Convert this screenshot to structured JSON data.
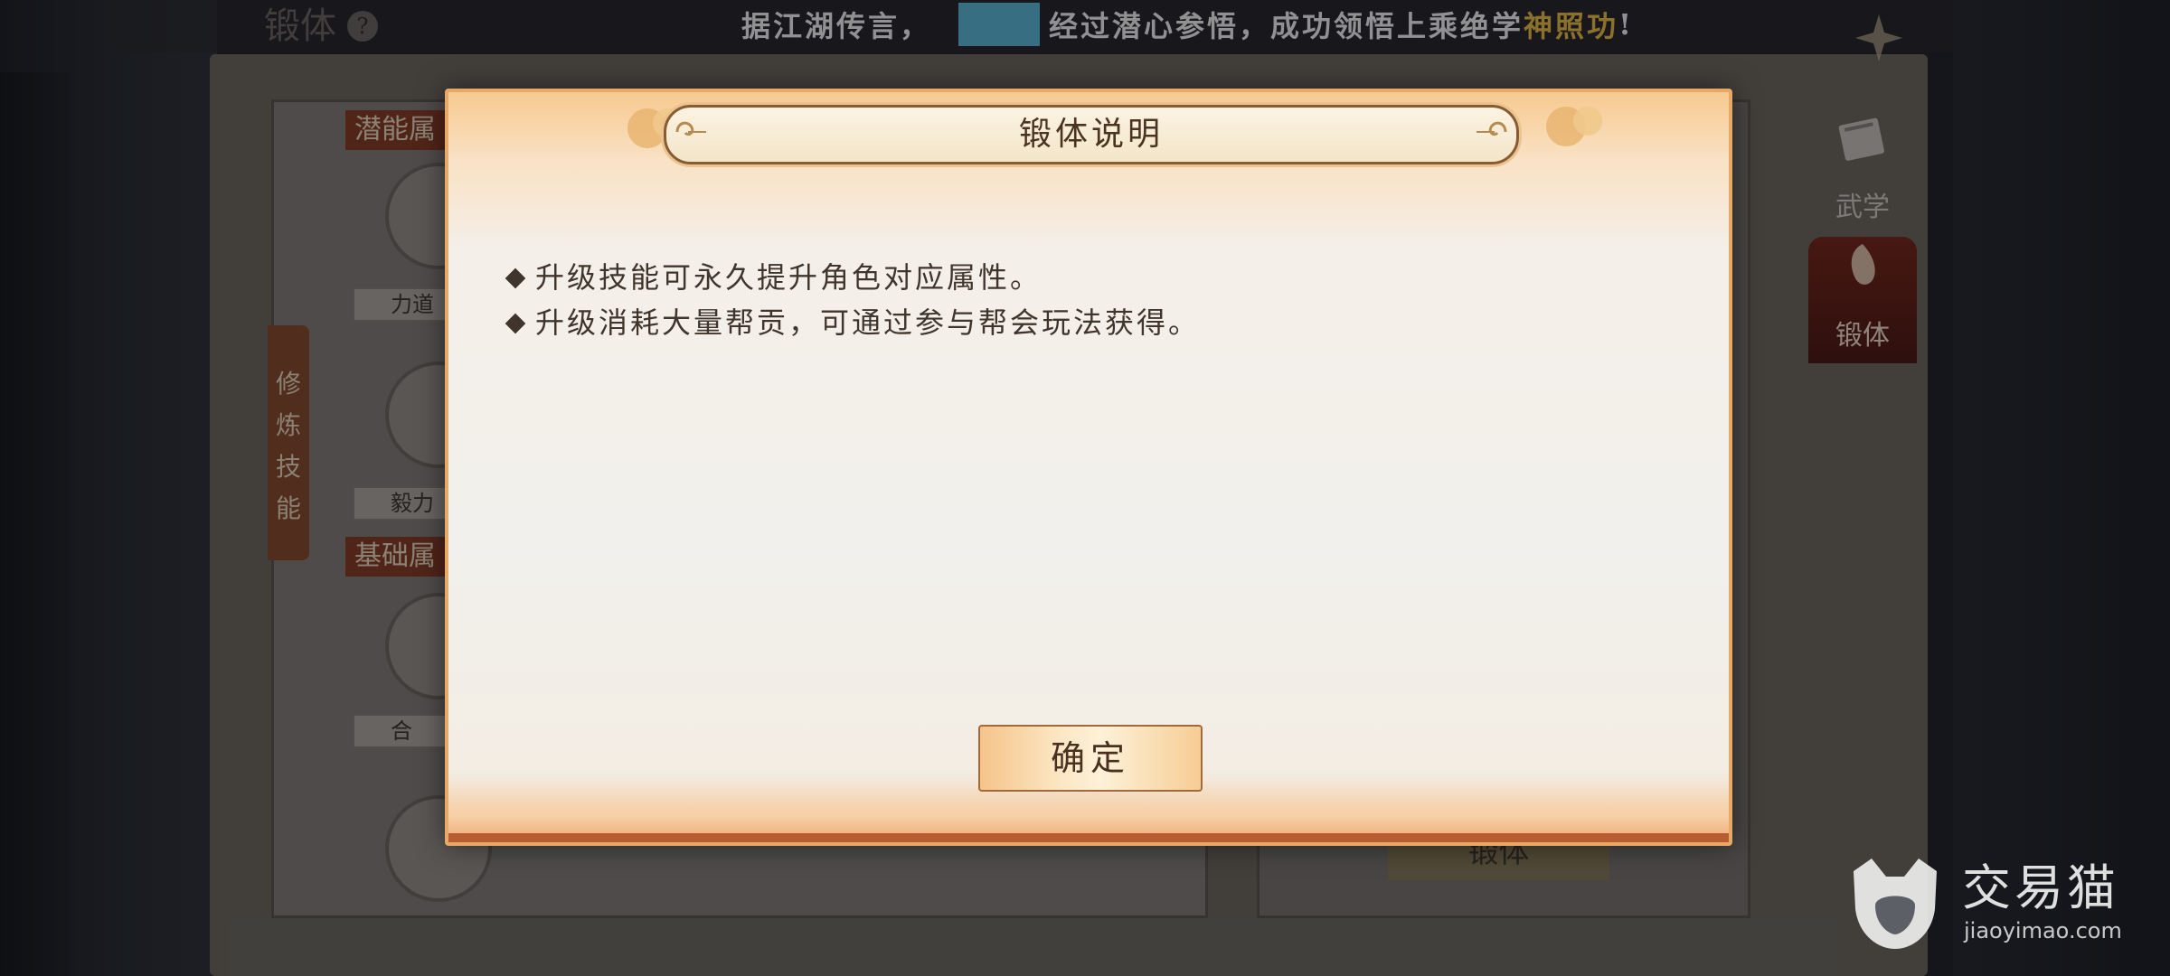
{
  "background": {
    "screen_title": "锻体",
    "help_icon": "?",
    "section_potential": "潜能属",
    "section_basic": "基础属",
    "vertical_tab": [
      "修",
      "炼",
      "技",
      "能"
    ],
    "skills": [
      "力道",
      "毅力",
      "合"
    ],
    "side_tabs": [
      {
        "label": "武学",
        "icon": "book-icon"
      },
      {
        "label": "锻体",
        "icon": "body-icon"
      }
    ],
    "forge_button": "锻体"
  },
  "marquee": {
    "prefix": "据江湖传言，",
    "middle": "经过潜心参悟，成功领悟上乘绝学",
    "highlight": "神照功",
    "suffix": "!"
  },
  "dialog": {
    "title": "锻体说明",
    "lines": [
      "升级技能可永久提升角色对应属性。",
      "升级消耗大量帮贡，可通过参与帮会玩法获得。"
    ],
    "confirm_label": "确定"
  },
  "watermark": {
    "brand": "交易猫",
    "url": "jiaoyimao.com"
  },
  "colors": {
    "dialog_border": "#e8a866",
    "title_text": "#4a3321",
    "marquee_highlight": "#f5c542"
  }
}
